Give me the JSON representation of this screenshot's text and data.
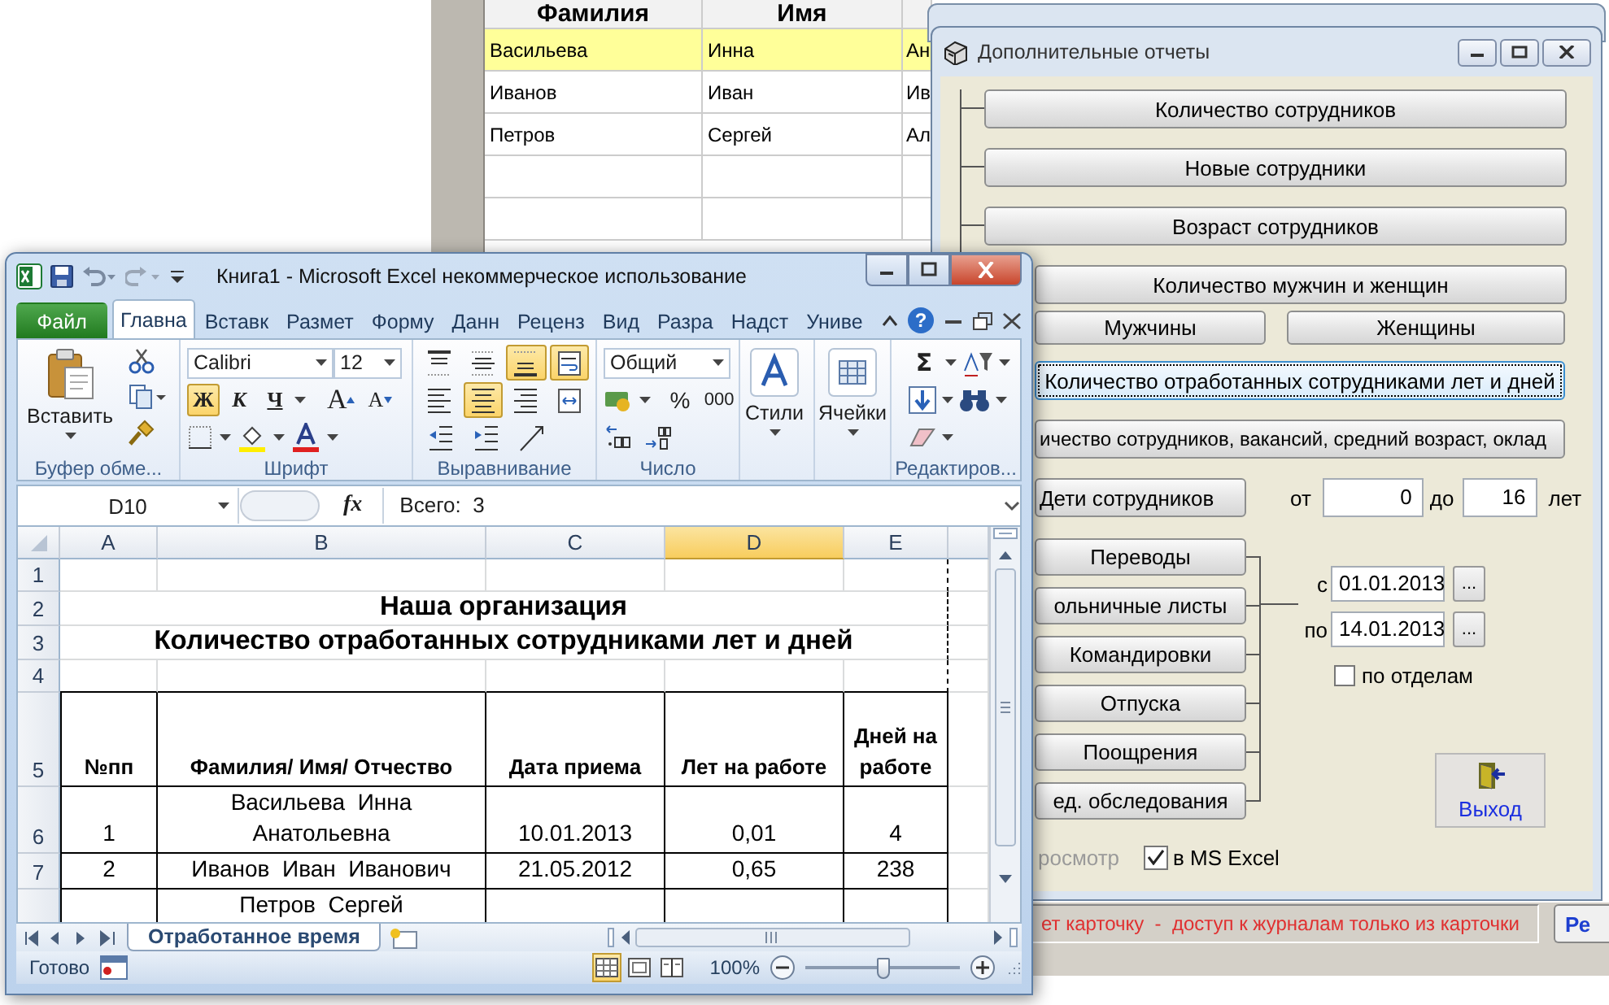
{
  "background_window": {
    "columns": [
      "Фамилия",
      "Имя"
    ],
    "rows": [
      {
        "cells": [
          "Васильева",
          "Инна",
          "Ан"
        ],
        "selected": true
      },
      {
        "cells": [
          "Иванов",
          "Иван",
          "Ив"
        ],
        "selected": false
      },
      {
        "cells": [
          "Петров",
          "Сергей",
          "Ал"
        ],
        "selected": false
      }
    ],
    "status_message": "ет карточку  -  доступ к журналам только из карточки",
    "side_button": "Ре"
  },
  "report_dialog": {
    "title": "Дополнительные отчеты",
    "report_buttons": [
      "Количество сотрудников",
      "Новые сотрудники",
      "Возраст сотрудников",
      "Количество мужчин и женщин"
    ],
    "gender_buttons": [
      "Мужчины",
      "Женщины"
    ],
    "worked_button": {
      "label": "Количество отработанных сотрудниками лет и дней",
      "focused": true
    },
    "summary_button": "ичество сотрудников, вакансий, средний возраст, оклад",
    "children": {
      "button": "Дети сотрудников",
      "from_label": "от",
      "from_value": "0",
      "to_label": "до",
      "to_value": "16",
      "unit": "лет"
    },
    "journal_buttons": [
      "Переводы",
      "ольничные листы",
      "Командировки",
      "Отпуска",
      "Поощрения",
      "ед. обследования"
    ],
    "period": [
      {
        "label": "с",
        "value": "01.01.2013",
        "picker": "..."
      },
      {
        "label": "по",
        "value": "14.01.2013",
        "picker": "..."
      }
    ],
    "by_department": {
      "label": "по отделам",
      "checked": false
    },
    "preview": {
      "label": "росмотр",
      "disabled": true
    },
    "excel_output": {
      "label": "в MS Excel",
      "checked": true
    },
    "exit_button": "Выход"
  },
  "excel": {
    "title": "Книга1  -  Microsoft Excel некоммерческое использование",
    "tabs": [
      {
        "label": "Файл",
        "kind": "file",
        "selected": false
      },
      {
        "label": "Главна",
        "kind": "tab",
        "selected": true
      },
      {
        "label": "Вставк",
        "kind": "tab",
        "selected": false
      },
      {
        "label": "Размет",
        "kind": "tab",
        "selected": false
      },
      {
        "label": "Форму",
        "kind": "tab",
        "selected": false
      },
      {
        "label": "Данн",
        "kind": "tab",
        "selected": false
      },
      {
        "label": "Реценз",
        "kind": "tab",
        "selected": false
      },
      {
        "label": "Вид",
        "kind": "tab",
        "selected": false
      },
      {
        "label": "Разра",
        "kind": "tab",
        "selected": false
      },
      {
        "label": "Надст",
        "kind": "tab",
        "selected": false
      },
      {
        "label": "Униве",
        "kind": "tab",
        "selected": false
      }
    ],
    "help": "?",
    "ribbon": {
      "clipboard": {
        "paste": "Вставить",
        "label": "Буфер обме..."
      },
      "font": {
        "name": "Calibri",
        "size": "12",
        "label": "Шрифт",
        "tools": [
          {
            "kind": "bold",
            "label": "Ж",
            "on": true
          },
          {
            "kind": "italic",
            "label": "К",
            "on": false
          },
          {
            "kind": "underline",
            "label": "Ч",
            "on": false
          },
          {
            "kind": "grow",
            "label": "A",
            "on": false
          },
          {
            "kind": "shrink",
            "label": "A",
            "on": false
          }
        ]
      },
      "alignment": {
        "label": "Выравнивание",
        "tools": [
          {
            "kind": "top",
            "on": false
          },
          {
            "kind": "middle",
            "on": false
          },
          {
            "kind": "bottom",
            "on": true
          },
          {
            "kind": "wrap",
            "on": true
          },
          {
            "kind": "left",
            "on": false
          },
          {
            "kind": "center",
            "on": true
          },
          {
            "kind": "right",
            "on": false
          },
          {
            "kind": "merge",
            "on": false
          },
          {
            "kind": "indent-less",
            "on": false
          },
          {
            "kind": "indent-more",
            "on": false
          },
          {
            "kind": "orientation",
            "on": false
          }
        ]
      },
      "number": {
        "format": "Общий",
        "percent": "%",
        "thousands": "000",
        "label": "Число"
      },
      "styles": {
        "label": "Стили"
      },
      "cells": {
        "label": "Ячейки"
      },
      "editing": {
        "sum": "Σ",
        "label": "Редактиров..."
      }
    },
    "sheet": {
      "name_box": "D10",
      "fx": "fx",
      "formula": "Всего:  3",
      "columns": [
        {
          "label": "A",
          "selected": false
        },
        {
          "label": "B",
          "selected": false
        },
        {
          "label": "C",
          "selected": false
        },
        {
          "label": "D",
          "selected": true
        },
        {
          "label": "E",
          "selected": false
        }
      ],
      "rows": [
        {
          "number": "1",
          "kind": "blank"
        },
        {
          "number": "2",
          "kind": "title",
          "text": "Наша организация"
        },
        {
          "number": "3",
          "kind": "title",
          "text": "Количество отработанных сотрудниками лет и дней"
        },
        {
          "number": "4",
          "kind": "blank"
        },
        {
          "number": "5",
          "kind": "header",
          "cells": [
            "№пп",
            "Фамилия/ Имя/ Отчество",
            "Дата приема",
            "Лет на работе",
            "Дней на работе"
          ]
        },
        {
          "number": "6",
          "kind": "data",
          "cells": [
            "1",
            "Васильева  Инна Анатольевна",
            "10.01.2013",
            "0,01",
            "4"
          ]
        },
        {
          "number": "7",
          "kind": "data",
          "cells": [
            "2",
            "Иванов  Иван  Иванович",
            "21.05.2012",
            "0,65",
            "238"
          ]
        },
        {
          "kind": "data",
          "cells": [
            null,
            "Петров  Сергей",
            null,
            null,
            null
          ]
        }
      ]
    },
    "sheet_tabs": [
      {
        "label": "Отработанное время",
        "selected": true
      }
    ],
    "status": {
      "text": "Готово",
      "views": [
        {
          "kind": "normal",
          "selected": true
        },
        {
          "kind": "layout",
          "selected": false
        },
        {
          "kind": "pagebreak",
          "selected": false
        }
      ],
      "zoom": "100%",
      "zoom_slider": {
        "level": 0.5
      }
    }
  }
}
